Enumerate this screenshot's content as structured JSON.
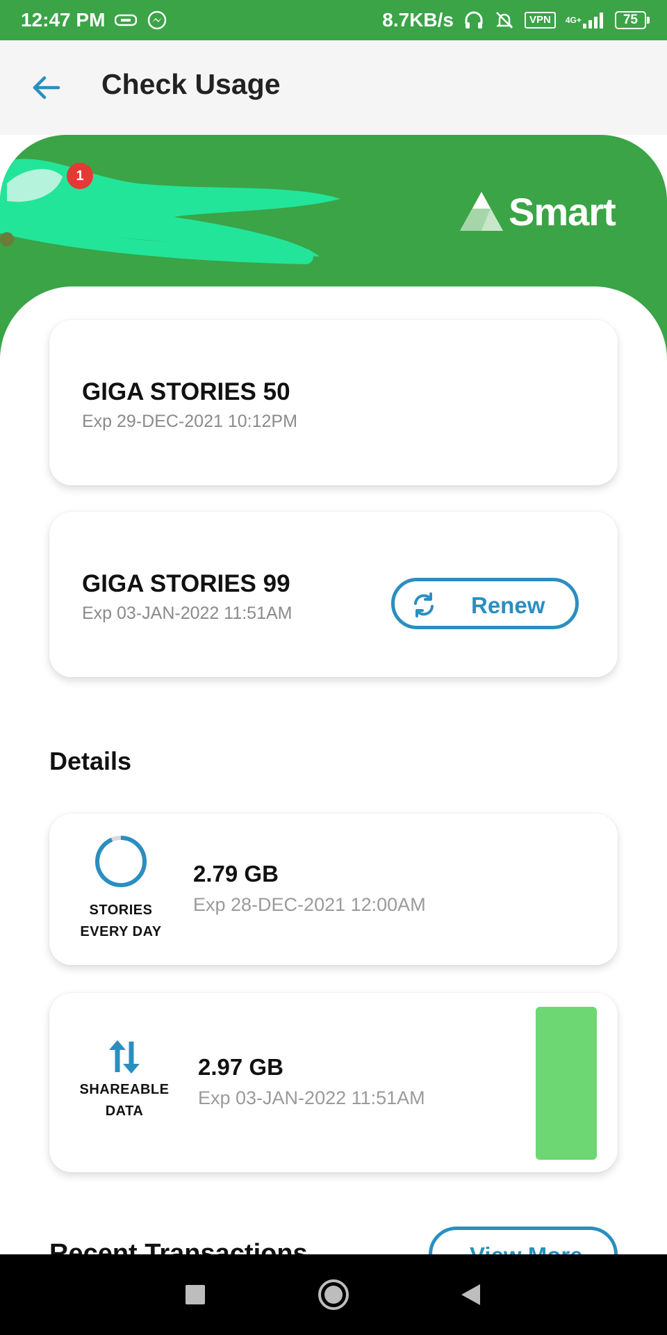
{
  "status_bar": {
    "time": "12:47 PM",
    "net_speed": "8.7KB/s",
    "vpn": "VPN",
    "network_type": "4G+",
    "battery": "75"
  },
  "appbar": {
    "title": "Check Usage"
  },
  "header": {
    "notification_count": "1",
    "brand": "Smart"
  },
  "promos": [
    {
      "name": "GIGA STORIES 50",
      "expiry": "Exp 29-DEC-2021 10:12PM"
    },
    {
      "name": "GIGA STORIES 99",
      "expiry": "Exp 03-JAN-2022 11:51AM",
      "action": "Renew"
    }
  ],
  "details": {
    "title": "Details",
    "items": [
      {
        "label_line1": "STORIES",
        "label_line2": "EVERY DAY",
        "value": "2.79 GB",
        "expiry": "Exp 28-DEC-2021 12:00AM"
      },
      {
        "label_line1": "SHAREABLE",
        "label_line2": "DATA",
        "value": "2.97 GB",
        "expiry": "Exp 03-JAN-2022 11:51AM"
      }
    ]
  },
  "recent": {
    "title": "Recent Transactions",
    "view_more": "View More"
  },
  "colors": {
    "brand_green": "#3aa447",
    "accent_blue": "#2a8fc0",
    "bar_green": "#6cd773"
  }
}
